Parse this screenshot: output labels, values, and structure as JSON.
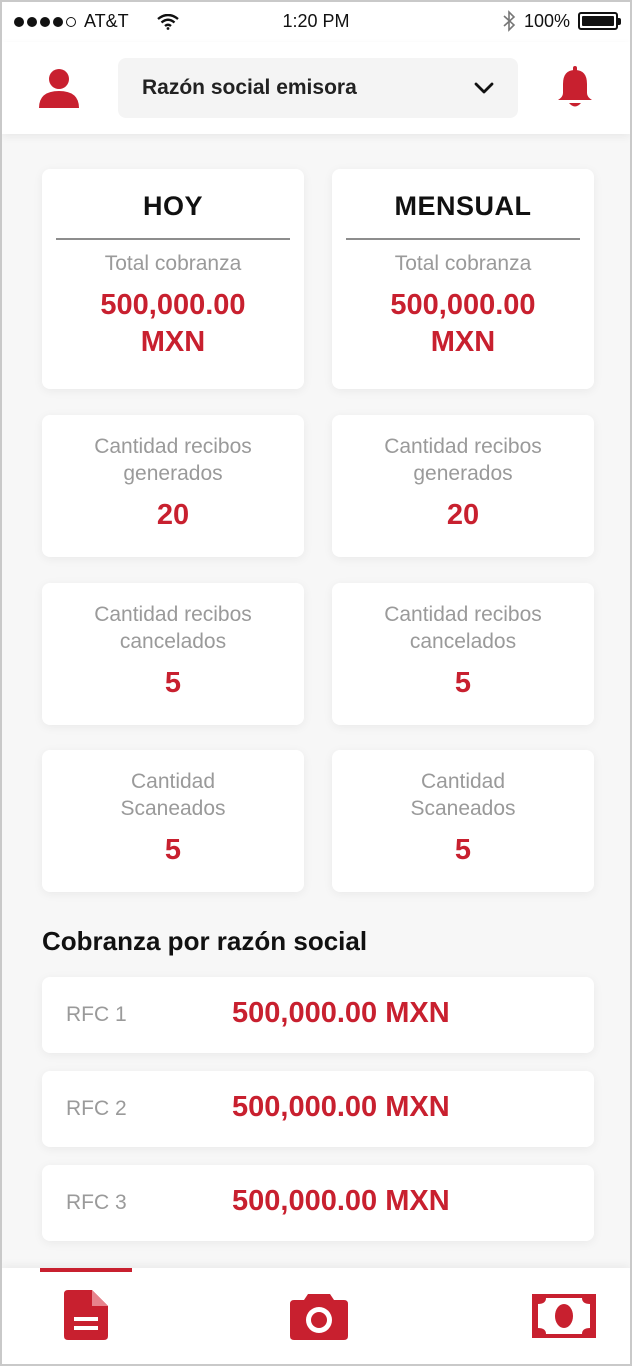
{
  "status_bar": {
    "carrier": "AT&T",
    "time": "1:20 PM",
    "battery": "100%",
    "signal_bars": 4,
    "icons": [
      "signal-dots",
      "wifi-icon",
      "bluetooth-icon",
      "battery-icon"
    ]
  },
  "header": {
    "selector_label": "Razón social emisora",
    "icons": [
      "user-icon",
      "chevron-down-icon",
      "bell-icon"
    ]
  },
  "summary": {
    "today": {
      "heading": "HOY",
      "total_label": "Total cobranza",
      "total_value": "500,000.00",
      "total_currency": "MXN",
      "generated_label_1": "Cantidad recibos",
      "generated_label_2": "generados",
      "generated_value": "20",
      "cancelled_label_1": "Cantidad recibos",
      "cancelled_label_2": "cancelados",
      "cancelled_value": "5",
      "scanned_label_1": "Cantidad",
      "scanned_label_2": "Scaneados",
      "scanned_value": "5"
    },
    "monthly": {
      "heading": "MENSUAL",
      "total_label": "Total cobranza",
      "total_value": "500,000.00",
      "total_currency": "MXN",
      "generated_label_1": "Cantidad recibos",
      "generated_label_2": "generados",
      "generated_value": "20",
      "cancelled_label_1": "Cantidad recibos",
      "cancelled_label_2": "cancelados",
      "cancelled_value": "5",
      "scanned_label_1": "Cantidad",
      "scanned_label_2": "Scaneados",
      "scanned_value": "5"
    }
  },
  "by_company": {
    "title": "Cobranza por razón social",
    "rows": [
      {
        "label": "RFC 1",
        "amount": "500,000.00 MXN"
      },
      {
        "label": "RFC 2",
        "amount": "500,000.00 MXN"
      },
      {
        "label": "RFC 3",
        "amount": "500,000.00 MXN"
      }
    ]
  },
  "tab_bar": {
    "active_tab": "documents",
    "tabs": [
      "document-icon",
      "camera-icon",
      "cash-icon"
    ]
  },
  "colors": {
    "accent": "#c8202f",
    "muted_text": "#9a9a9a",
    "background": "#f7f7f7"
  }
}
